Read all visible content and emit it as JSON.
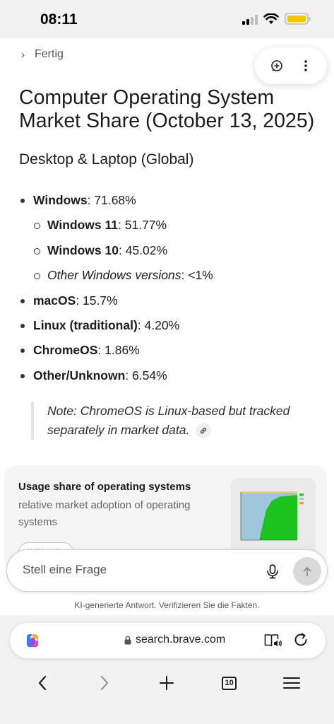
{
  "status": {
    "time": "08:11",
    "battery_color": "#f5c400"
  },
  "header": {
    "collapse_label": "Fertig",
    "new_chat_icon": "chat-plus-icon",
    "more_icon": "more-vertical-icon"
  },
  "answer": {
    "title": "Computer Operating System Market Share (October 13, 2025)",
    "section": "Desktop & Laptop (Global)",
    "items": [
      {
        "name": "Windows",
        "value": "71.68%"
      },
      {
        "name": "Windows 11",
        "value": "51.77%"
      },
      {
        "name": "Windows 10",
        "value": "45.02%"
      },
      {
        "name": "Other Windows versions",
        "value": "<1%"
      },
      {
        "name": "macOS",
        "value": "15.7%"
      },
      {
        "name": "Linux (traditional)",
        "value": "4.20%"
      },
      {
        "name": "ChromeOS",
        "value": "1.86%"
      },
      {
        "name": "Other/Unknown",
        "value": "6.54%"
      }
    ],
    "note": "Note: ChromeOS is Linux-based but tracked separately in market data."
  },
  "card": {
    "title": "Usage share of operating systems",
    "description": "relative market adoption of operating systems",
    "source": "Wikipedia"
  },
  "ask": {
    "placeholder": "Stell eine Frage",
    "disclaimer": "KI-generierte Antwort. Verifizieren Sie die Fakten."
  },
  "browser": {
    "url": "search.brave.com",
    "tab_count": "10"
  }
}
